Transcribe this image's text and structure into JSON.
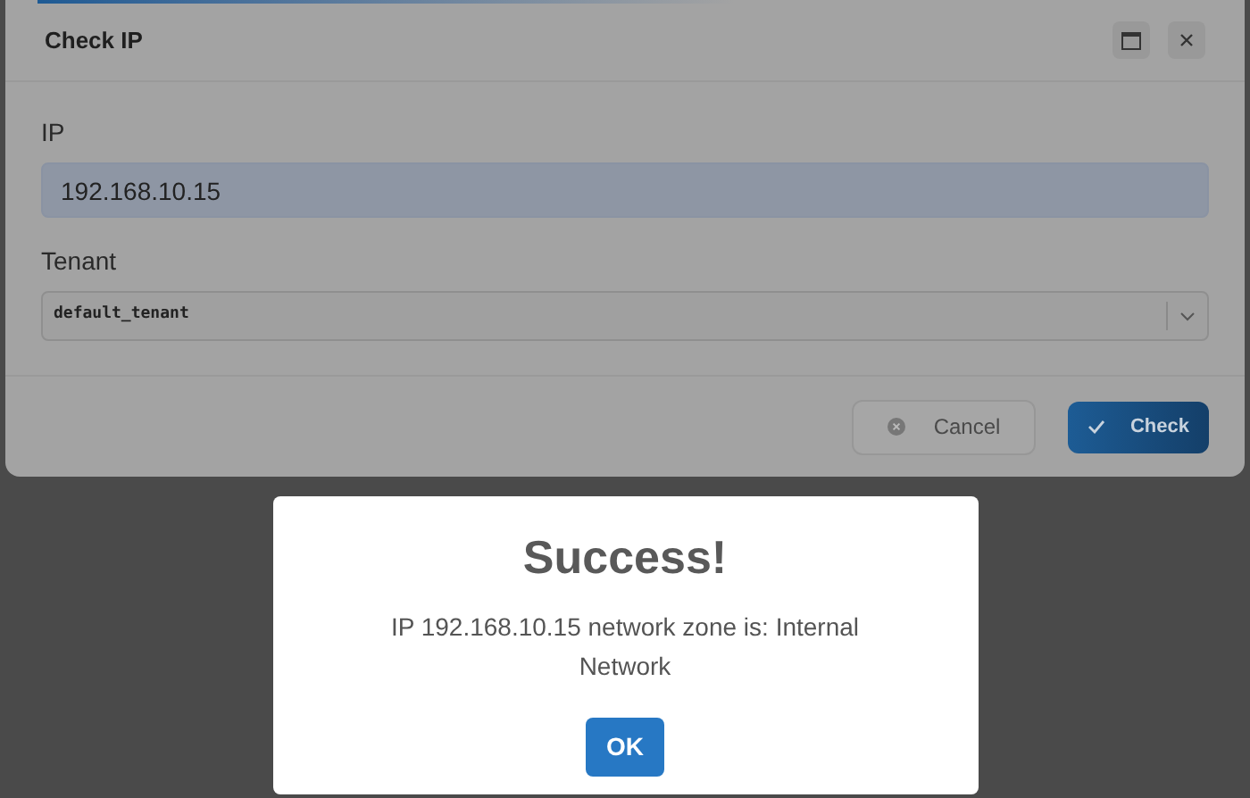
{
  "dialog": {
    "title": "Check IP",
    "fields": [
      {
        "label": "IP",
        "kind": "text",
        "value": "192.168.10.15"
      },
      {
        "label": "Tenant",
        "kind": "select",
        "value": "default_tenant"
      }
    ],
    "buttons": [
      {
        "label": "Cancel",
        "kind": "secondary"
      },
      {
        "label": "Check",
        "kind": "primary"
      }
    ]
  },
  "alert": {
    "title": "Success!",
    "message": "IP 192.168.10.15 network zone is: Internal Network",
    "button": "OK"
  }
}
